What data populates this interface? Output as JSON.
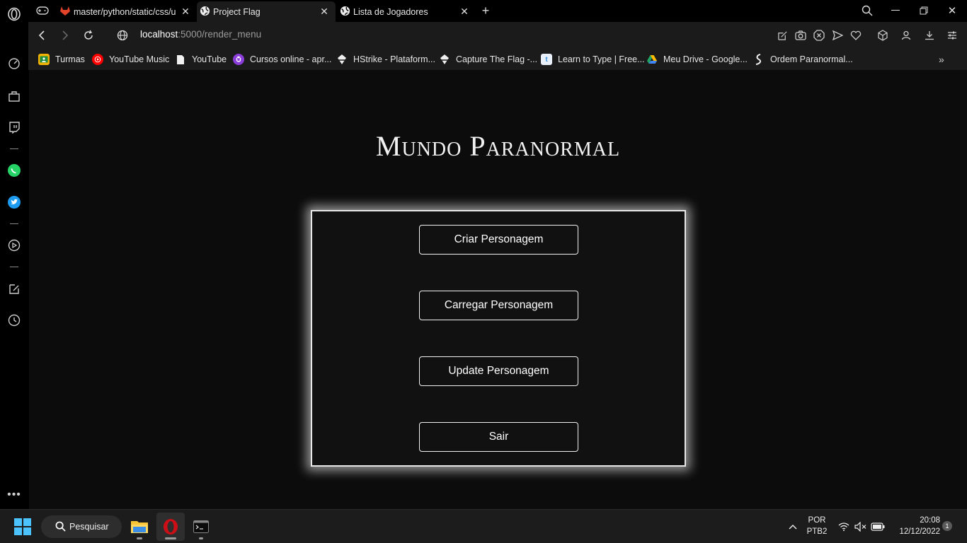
{
  "browser": {
    "tabs": [
      {
        "title": "master/python/static/css/u",
        "favicon": "gitlab-icon",
        "active": false
      },
      {
        "title": "Project Flag",
        "favicon": "globe-icon",
        "active": true
      },
      {
        "title": "Lista de Jogadores",
        "favicon": "globe-icon",
        "active": false
      }
    ],
    "url_host": "localhost",
    "url_path": ":5000/render_menu"
  },
  "bookmarks": [
    {
      "label": "Turmas",
      "icon": "classroom-icon",
      "color": "#f2b203"
    },
    {
      "label": "YouTube Music",
      "icon": "youtube-music-icon",
      "color": "#ff0000"
    },
    {
      "label": "YouTube",
      "icon": "document-icon",
      "color": "#ffffff"
    },
    {
      "label": "Cursos online - apr...",
      "icon": "udemy-icon",
      "color": "#8b3dd9"
    },
    {
      "label": "HStrike - Plataform...",
      "icon": "hstrike-icon",
      "color": "#ffffff"
    },
    {
      "label": "Capture The Flag -...",
      "icon": "ctf-icon",
      "color": "#ffffff"
    },
    {
      "label": "Learn to Type | Free...",
      "icon": "typing-icon",
      "color": "#3b8fd9"
    },
    {
      "label": "Meu Drive - Google...",
      "icon": "google-drive-icon",
      "color": "#1fa463"
    },
    {
      "label": "Ordem Paranormal...",
      "icon": "ordem-icon",
      "color": "#ffffff"
    }
  ],
  "page": {
    "title": "Mundo Paranormal",
    "menu": {
      "create": "Criar Personagem",
      "load": "Carregar Personagem",
      "update": "Update Personagem",
      "exit": "Sair"
    }
  },
  "taskbar": {
    "search_label": "Pesquisar",
    "language": "POR",
    "keyboard": "PTB2",
    "time": "20:08",
    "date": "12/12/2022",
    "notifications": "1"
  }
}
